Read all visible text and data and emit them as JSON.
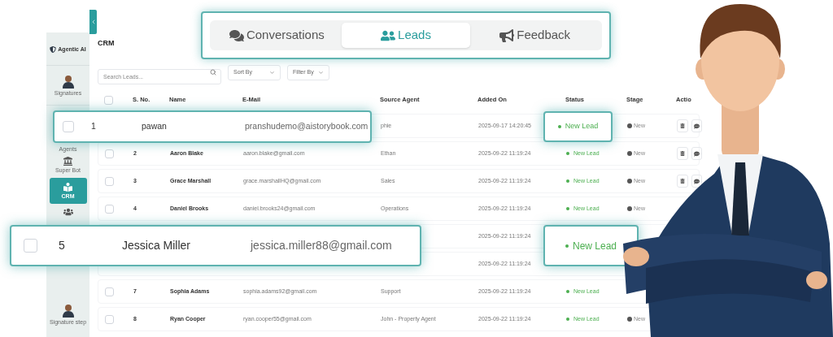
{
  "tabs": [
    {
      "label": "Conversations",
      "selected": false
    },
    {
      "label": "Leads",
      "selected": true
    },
    {
      "label": "Feedback",
      "selected": false
    }
  ],
  "sidebar": {
    "logo": "Agentic AI",
    "items": [
      {
        "kind": "avatar",
        "label": "Signatures",
        "selected": false
      },
      {
        "kind": "label",
        "label": "Agents",
        "selected": false
      },
      {
        "kind": "bot",
        "label": "Super Bot",
        "selected": false
      },
      {
        "kind": "crm",
        "label": "CRM",
        "selected": true
      },
      {
        "kind": "team",
        "selected": false
      }
    ],
    "footer": {
      "kind": "avatar",
      "label": "Signature step",
      "selected": false
    }
  },
  "page_title": "CRM",
  "toolbar": {
    "search": {
      "placeholder": "Search Leads..."
    },
    "sort": "Sort By",
    "filter": "Filter By"
  },
  "table": {
    "header_checked": false,
    "columns": [
      "S. No.",
      "Name",
      "E-Mail",
      "Source Agent",
      "Added On",
      "Status",
      "Stage",
      "Actio"
    ],
    "rows": [
      {
        "source_agent": "phie",
        "added_on": "2025-09-17 14:20:45",
        "stage": "New",
        "action_icons": true
      },
      {
        "checked": false,
        "s_no": "2",
        "name": "Aaron Blake",
        "email": "aaron.blake@gmail.com",
        "source_agent": "Ethan",
        "added_on": "2025-09-22 11:19:24",
        "status": "New Lead",
        "stage": "New",
        "action_icons": true
      },
      {
        "checked": false,
        "s_no": "3",
        "name": "Grace Marshall",
        "email": "grace.marshallHQ@gmail.com",
        "source_agent": "Sales",
        "added_on": "2025-09-22 11:19:24",
        "status": "New Lead",
        "stage": "New",
        "action_icons": true
      },
      {
        "checked": false,
        "s_no": "4",
        "name": "Daniel Brooks",
        "email": "daniel.brooks24@gmail.com",
        "source_agent": "Operations",
        "added_on": "2025-09-22 11:19:24",
        "status": "New Lead",
        "stage": "New"
      },
      {
        "added_on": "2025-09-22 11:19:24"
      },
      {
        "added_on": "2025-09-22 11:19:24"
      },
      {
        "checked": false,
        "s_no": "7",
        "name": "Sophia Adams",
        "email": "sophia.adams92@gmail.com",
        "source_agent": "Support",
        "added_on": "2025-09-22 11:19:24",
        "status": "New Lead"
      },
      {
        "checked": false,
        "s_no": "8",
        "name": "Ryan Cooper",
        "email": "ryan.cooper55@gmail.com",
        "source_agent": "John - Property Agent",
        "added_on": "2025-09-22 11:19:24",
        "status": "New Lead",
        "stage": "New"
      }
    ]
  },
  "highlights": [
    {
      "checked": false,
      "s_no": "1",
      "name": "pawan",
      "email": "pranshudemo@aistorybook.com",
      "status": "New Lead"
    },
    {
      "checked": false,
      "s_no": "5",
      "name": "Jessica Miller",
      "email": "jessica.miller88@gmail.com",
      "status": "New Lead"
    }
  ]
}
